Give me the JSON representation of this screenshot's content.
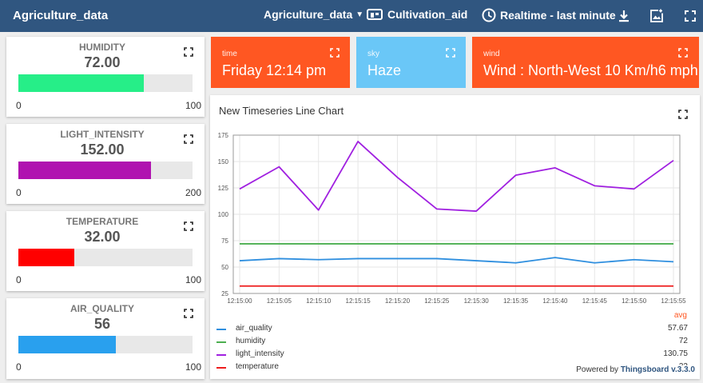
{
  "topbar": {
    "title": "Agriculture_data",
    "dashboard_select": "Agriculture_data",
    "cultivation": "Cultivation_aid",
    "timewindow": "Realtime - last minute"
  },
  "gauges": [
    {
      "title": "HUMIDITY",
      "value": "72.00",
      "min": "0",
      "max": "100",
      "fraction": 0.72,
      "color": "#26ee88"
    },
    {
      "title": "LIGHT_INTENSITY",
      "value": "152.00",
      "min": "0",
      "max": "200",
      "fraction": 0.76,
      "color": "#b012b0"
    },
    {
      "title": "TEMPERATURE",
      "value": "32.00",
      "min": "0",
      "max": "100",
      "fraction": 0.32,
      "color": "#ff0000"
    },
    {
      "title": "AIR_QUALITY",
      "value": "56",
      "min": "0",
      "max": "100",
      "fraction": 0.56,
      "color": "#29a0ee"
    }
  ],
  "info": {
    "time": {
      "label": "time",
      "value": "Friday 12:14 pm",
      "color": "#ff5722"
    },
    "sky": {
      "label": "sky",
      "value": "Haze",
      "color": "#6ac7f7"
    },
    "wind": {
      "label": "wind",
      "value": "Wind : North-West 10 Km/h6 mph",
      "color": "#ff5722"
    }
  },
  "chart": {
    "title": "New Timeseries Line Chart",
    "avg_header": "avg",
    "powered_by": "Powered by",
    "brand": "Thingsboard v.3.3.0"
  },
  "chart_data": {
    "type": "line",
    "x": [
      "12:15:00",
      "12:15:05",
      "12:15:10",
      "12:15:15",
      "12:15:20",
      "12:15:25",
      "12:15:30",
      "12:15:35",
      "12:15:40",
      "12:15:45",
      "12:15:50",
      "12:15:55"
    ],
    "ylim": [
      25,
      175
    ],
    "yticks": [
      25,
      50,
      75,
      100,
      125,
      150,
      175
    ],
    "grid": true,
    "series": [
      {
        "name": "air_quality",
        "color": "#2f8fdf",
        "avg": "57.67",
        "values": [
          56,
          58,
          57,
          58,
          58,
          58,
          56,
          54,
          59,
          54,
          57,
          55
        ]
      },
      {
        "name": "humidity",
        "color": "#4caf50",
        "avg": "72",
        "values": [
          72,
          72,
          72,
          72,
          72,
          72,
          72,
          72,
          72,
          72,
          72,
          72
        ]
      },
      {
        "name": "light_intensity",
        "color": "#a020e0",
        "avg": "130.75",
        "values": [
          124,
          145,
          104,
          169,
          135,
          105,
          103,
          137,
          144,
          127,
          124,
          151
        ]
      },
      {
        "name": "temperature",
        "color": "#ee1c1c",
        "avg": "32",
        "values": [
          32,
          32,
          32,
          32,
          32,
          32,
          32,
          32,
          32,
          32,
          32,
          32
        ]
      }
    ]
  }
}
